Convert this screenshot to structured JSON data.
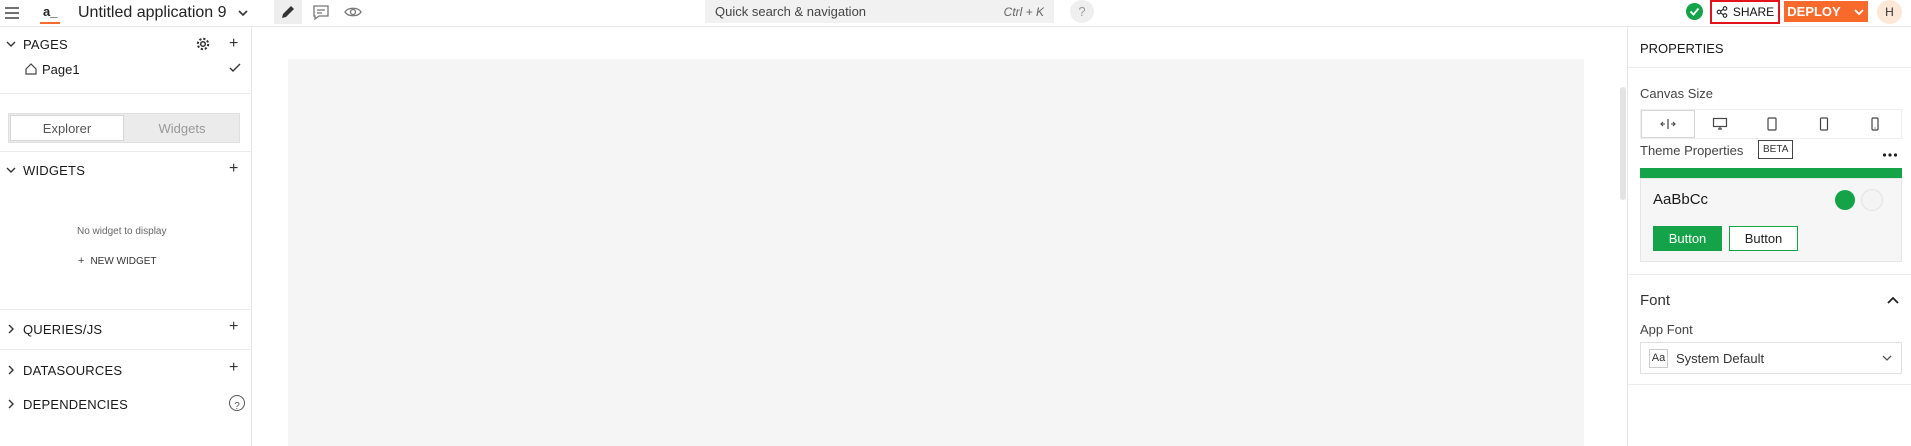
{
  "topbar": {
    "app_name": "Untitled application 9",
    "search_placeholder": "Quick search & navigation",
    "search_shortcut": "Ctrl + K",
    "help": "?",
    "share_label": "SHARE",
    "deploy_label": "DEPLOY",
    "avatar_initial": "H",
    "logo_text": "a_"
  },
  "sidebar": {
    "pages_title": "PAGES",
    "page_name": "Page1",
    "tabs": [
      "Explorer",
      "Widgets"
    ],
    "widgets_title": "WIDGETS",
    "no_widget": "No widget to display",
    "new_widget": "NEW WIDGET",
    "queries_title": "QUERIES/JS",
    "datasources_title": "DATASOURCES",
    "dependencies_title": "DEPENDENCIES",
    "dependencies_help": "?"
  },
  "properties": {
    "title": "PROPERTIES",
    "canvas_size_label": "Canvas Size",
    "theme_label": "Theme Properties",
    "beta_badge": "BETA",
    "theme_sample_text": "AaBbCc",
    "primary_button": "Button",
    "secondary_button": "Button",
    "font_section": "Font",
    "app_font_label": "App Font",
    "font_icon_text": "Aa",
    "font_value": "System Default"
  },
  "colors": {
    "accent": "#15a349",
    "brand": "#f86a2b",
    "share_border": "#e0141a",
    "status_ok": "#15a349"
  }
}
